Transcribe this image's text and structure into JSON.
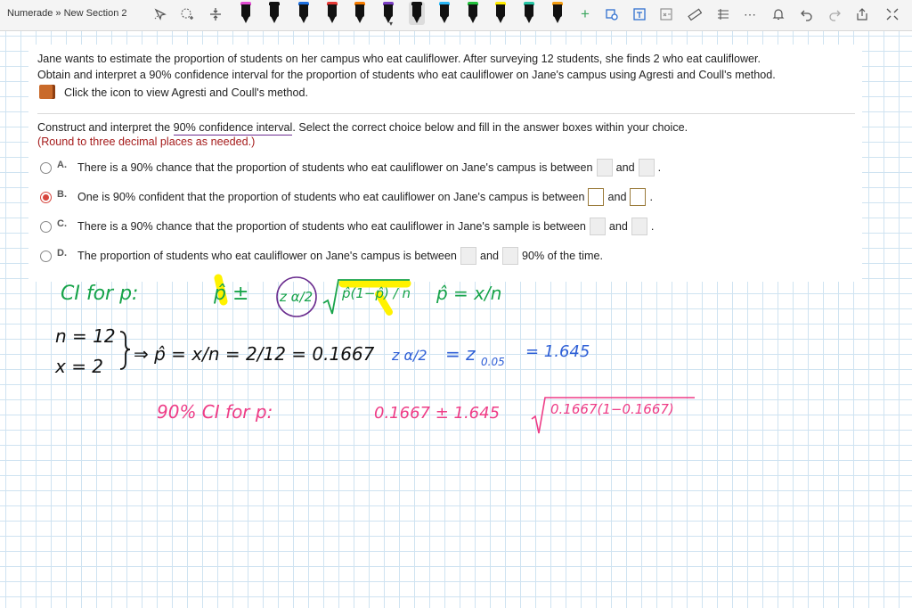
{
  "toolbar": {
    "breadcrumb": "Numerade » New Section 2",
    "pens": [
      {
        "name": "pen-magenta",
        "color": "#e14bd1"
      },
      {
        "name": "pen-black",
        "color": "#111111"
      },
      {
        "name": "pen-blue",
        "color": "#1d6fe0"
      },
      {
        "name": "pen-red",
        "color": "#e53935"
      },
      {
        "name": "pen-orange",
        "color": "#f57c00"
      },
      {
        "name": "pen-purple",
        "color": "#7b3fc4"
      },
      {
        "name": "pen-black-selected",
        "color": "#111111"
      },
      {
        "name": "pen-lightblue",
        "color": "#29b6f6"
      },
      {
        "name": "pen-green",
        "color": "#21c03a"
      },
      {
        "name": "pen-yellow",
        "color": "#ffeb00"
      },
      {
        "name": "pen-teal",
        "color": "#26c6a6"
      },
      {
        "name": "pen-orange-2",
        "color": "#f39c12"
      }
    ],
    "plus": "+"
  },
  "question": {
    "line1": "Jane wants to estimate the proportion of students on her campus who eat cauliflower. After surveying 12 students, she finds 2 who eat cauliflower.",
    "line2": "Obtain and interpret a 90% confidence interval for the proportion of students who eat cauliflower on Jane's campus using Agresti and Coull's method.",
    "book_text": "Click the icon to view Agresti and Coull's method.",
    "construct_pre": "Construct and interpret the ",
    "construct_term": "90% confidence interval",
    "construct_post": ". Select the correct choice below and fill in the answer boxes within your choice.",
    "round_note": "(Round to three decimal places as needed.)"
  },
  "choices": [
    {
      "letter": "A.",
      "text": "There is a 90% chance that the proportion of students who eat cauliflower on Jane's campus is between",
      "mid": "and",
      "end": ".",
      "selected": false
    },
    {
      "letter": "B.",
      "text": "One is 90% confident that the proportion of students who eat cauliflower on Jane's campus is between",
      "mid": "and",
      "end": ".",
      "selected": true
    },
    {
      "letter": "C.",
      "text": "There is a 90% chance that the proportion of students who eat cauliflower in Jane's sample is between",
      "mid": "and",
      "end": ".",
      "selected": false
    },
    {
      "letter": "D.",
      "text": "The proportion of students who eat cauliflower on Jane's campus is between",
      "mid": "and",
      "end": "90% of the time.",
      "selected": false
    }
  ],
  "handwriting": {
    "ci_label": "CI for p:",
    "formula_phat": "p̂ ±",
    "z_alpha": "z α/2",
    "sqrt_body": "p̂(1−p̂) / n",
    "phat_def": "p̂ = x/n",
    "n_val": "n = 12",
    "x_val": "x = 2",
    "phat_calc": "⇒ p̂ = x/n = 2/12 = 0.1667",
    "z_calc_lhs": "z α/2",
    "z_calc_mid": "= z",
    "z_sub": "0.05",
    "z_calc_rhs": "= 1.645",
    "ci_line_label": "90% CI for p:",
    "ci_line_val": "0.1667 ± 1.645",
    "ci_line_sqrt": "0.1667(1−0.1667)"
  },
  "colors": {
    "green_ink": "#17a34a",
    "black_ink": "#111111",
    "blue_ink": "#2e5fd6",
    "pink_ink": "#ee3c86",
    "purple_ink": "#6a2c8e",
    "highlight": "#fff200"
  }
}
